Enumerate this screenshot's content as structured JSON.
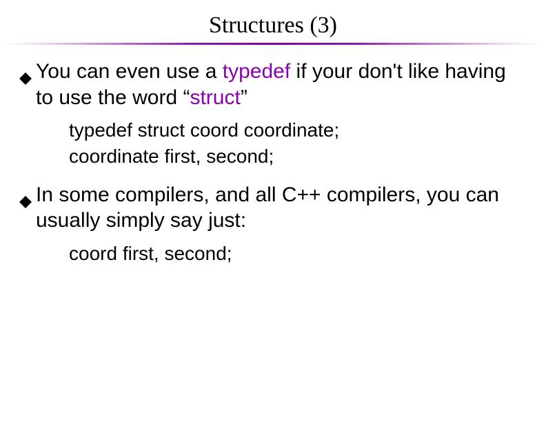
{
  "title": "Structures (3)",
  "bullets": [
    {
      "segments": [
        {
          "text": "You can even use a ",
          "accent": false
        },
        {
          "text": "typedef",
          "accent": true
        },
        {
          "text": " if your don't like having to use the word “",
          "accent": false
        },
        {
          "text": "struct",
          "accent": true
        },
        {
          "text": "”",
          "accent": false
        }
      ],
      "sublines": [
        "typedef struct coord coordinate;",
        "coordinate first, second;"
      ]
    },
    {
      "segments": [
        {
          "text": "In some compilers, and all C++ compilers, you can usually simply say just:",
          "accent": false
        }
      ],
      "sublines": [
        "coord first, second;"
      ]
    }
  ]
}
